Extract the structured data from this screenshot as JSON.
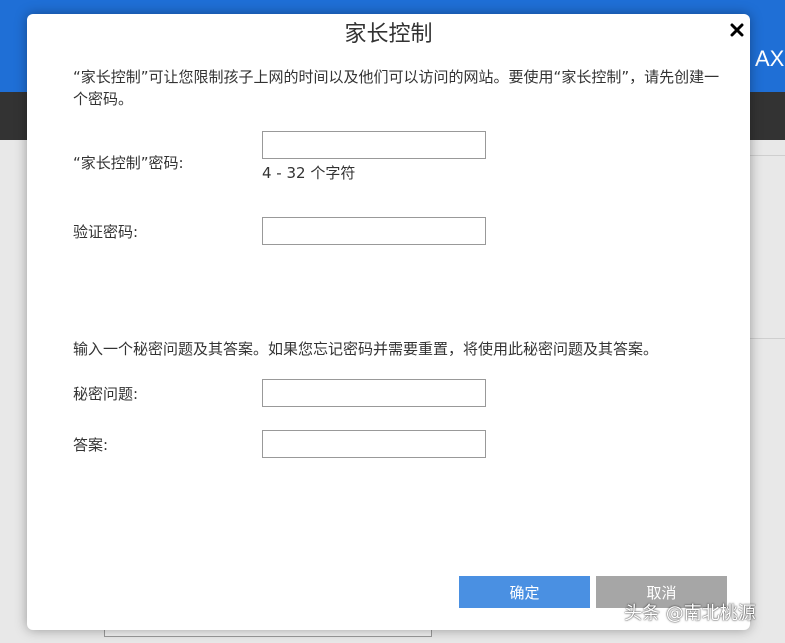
{
  "background": {
    "header_text": "AX"
  },
  "modal": {
    "title": "家长控制",
    "close_icon": "close-icon",
    "intro": "“家长控制”可让您限制孩子上网的时间以及他们可以访问的网站。要使用“家长控制”，请先创建一个密码。",
    "password": {
      "label": "“家长控制”密码:",
      "value": "",
      "hint": "4 - 32 个字符"
    },
    "confirm_password": {
      "label": "验证密码:",
      "value": ""
    },
    "secret_section_desc": "输入一个秘密问题及其答案。如果您忘记密码并需要重置，将使用此秘密问题及其答案。",
    "secret_question": {
      "label": "秘密问题:",
      "value": ""
    },
    "answer": {
      "label": "答案:",
      "value": ""
    },
    "buttons": {
      "ok": "确定",
      "cancel": "取消"
    }
  },
  "watermark": "头条 @南北桃源",
  "colors": {
    "header": "#1f6fd6",
    "nav": "#333333",
    "ok_button": "#4a90e2",
    "cancel_button": "#a6a6a6"
  }
}
